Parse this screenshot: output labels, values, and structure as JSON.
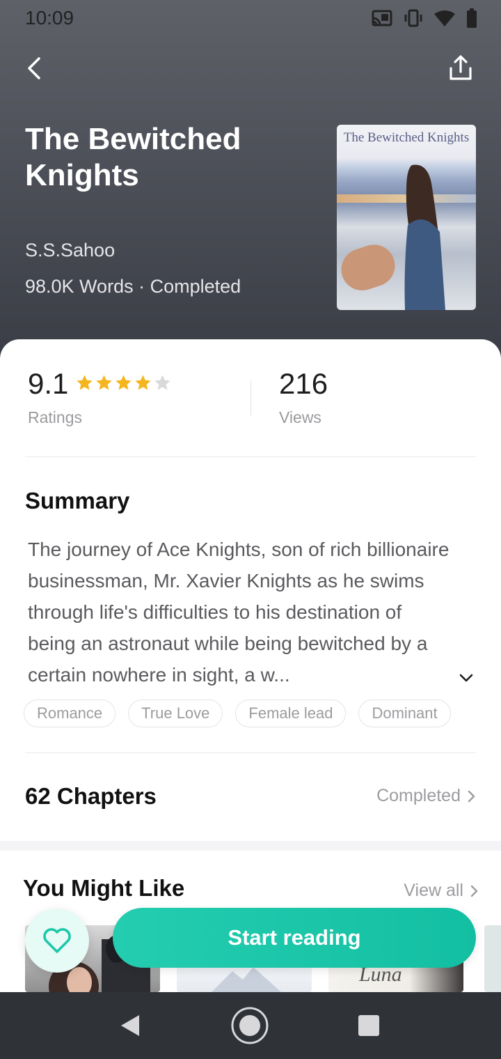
{
  "status_bar": {
    "time": "10:09"
  },
  "book": {
    "title": "The Bewitched Knights",
    "author": "S.S.Sahoo",
    "meta": "98.0K Words · Completed",
    "cover_title": "The Bewitched Knights"
  },
  "stats": {
    "rating_value": "9.1",
    "rating_stars": 4,
    "rating_stars_max": 5,
    "rating_label": "Ratings",
    "views_value": "216",
    "views_label": "Views"
  },
  "summary": {
    "heading": "Summary",
    "text": "The journey of Ace Knights, son of rich billionaire businessman, Mr. Xavier Knights as he swims through life's difficulties to his destination of being an astronaut while being bewitched by a certain nowhere in sight, a w..."
  },
  "tags": [
    "Romance",
    "True Love",
    "Female lead",
    "Dominant"
  ],
  "chapters": {
    "title": "62 Chapters",
    "status": "Completed"
  },
  "recommendations": {
    "heading": "You Might Like",
    "view_all": "View all",
    "cover3_text": "Luna"
  },
  "actions": {
    "start_reading": "Start reading"
  },
  "colors": {
    "accent": "#1dc7a9",
    "star": "#f5b51f",
    "star_empty": "#d9d9dc",
    "hero": "#4f525a"
  }
}
